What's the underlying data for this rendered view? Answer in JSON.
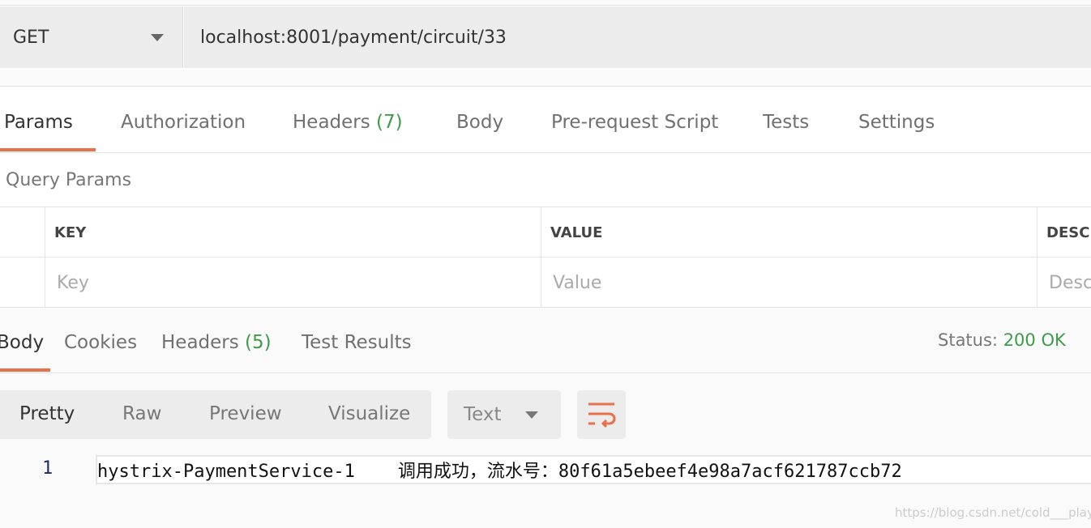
{
  "request": {
    "method": "GET",
    "url": "localhost:8001/payment/circuit/33"
  },
  "req_tabs": [
    {
      "label": "Params"
    },
    {
      "label": "Authorization"
    },
    {
      "label": "Headers",
      "count": "(7)"
    },
    {
      "label": "Body"
    },
    {
      "label": "Pre-request Script"
    },
    {
      "label": "Tests"
    },
    {
      "label": "Settings"
    }
  ],
  "query_params": {
    "title": "Query Params",
    "columns": [
      "KEY",
      "VALUE",
      "DESCR"
    ],
    "placeholders": [
      "Key",
      "Value",
      "Desc"
    ]
  },
  "resp_tabs": [
    {
      "label": "Body"
    },
    {
      "label": "Cookies"
    },
    {
      "label": "Headers",
      "count": "(5)"
    },
    {
      "label": "Test Results"
    }
  ],
  "status": {
    "label": "Status:",
    "value": "200 OK"
  },
  "view_modes": [
    "Pretty",
    "Raw",
    "Preview",
    "Visualize"
  ],
  "format": "Text",
  "response": {
    "line_number": "1",
    "text": "hystrix-PaymentService-1    调用成功，流水号：80f61a5ebeef4e98a7acf621787ccb72"
  },
  "watermark": "https://blog.csdn.net/cold___play",
  "colors": {
    "accent": "#e8714a",
    "success": "#3f9a4a"
  }
}
